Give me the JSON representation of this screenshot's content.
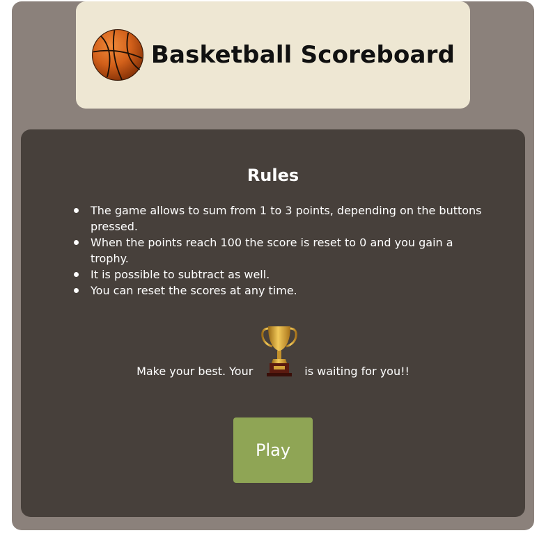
{
  "header": {
    "title": "Basketball Scoreboard",
    "logo_icon": "basketball-icon"
  },
  "rules": {
    "heading": "Rules",
    "items": [
      "The game allows to sum from 1 to 3 points, depending on the buttons pressed.",
      "When the points reach 100 the score is reset to 0 and you gain a trophy.",
      "It is possible to subtract as well.",
      "You can reset the scores at any time."
    ]
  },
  "motivation": {
    "before": "Make your best. Your",
    "icon": "trophy-icon",
    "after": "is waiting for you!!"
  },
  "actions": {
    "play_label": "Play"
  },
  "colors": {
    "page_bg": "#ffffff",
    "frame_bg": "#8b817b",
    "header_bg": "#eee7d3",
    "panel_bg": "#47403b",
    "play_button": "#8fa555",
    "text_light": "#ffffff",
    "text_dark": "#111111"
  }
}
